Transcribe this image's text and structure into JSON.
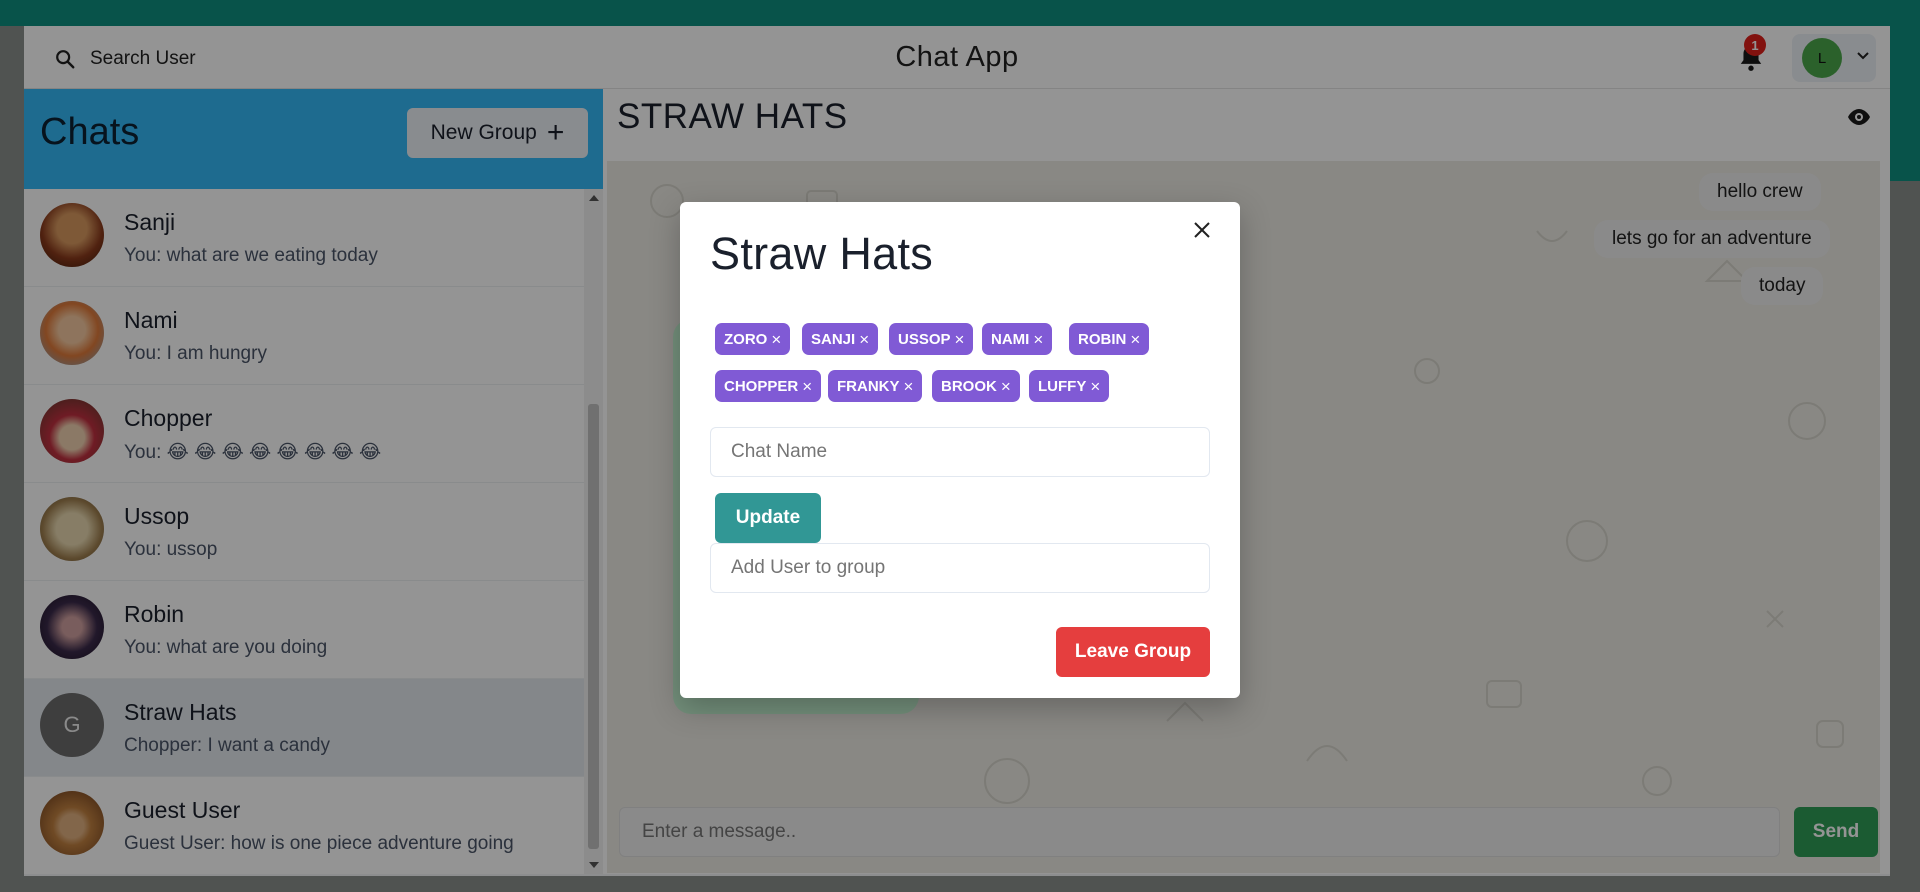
{
  "header": {
    "search_label": "Search User",
    "app_title": "Chat App",
    "notification_count": "1",
    "profile_initial": "L"
  },
  "sidebar": {
    "title": "Chats",
    "new_group_label": "New Group",
    "chats": [
      {
        "name": "Sanji",
        "preview": "You: what are we eating today",
        "avatar_color": "#8a3a1c"
      },
      {
        "name": "Nami",
        "preview": "You: I am hungry",
        "avatar_color": "#e07a3a"
      },
      {
        "name": "Chopper",
        "preview": "You: 😂 😂 😂 😂 😂 😂 😂 😂",
        "avatar_color": "#5a3a2a"
      },
      {
        "name": "Ussop",
        "preview": "You: ussop",
        "avatar_color": "#a08050"
      },
      {
        "name": "Robin",
        "preview": "You: what are you doing",
        "avatar_color": "#3a2a4a"
      },
      {
        "name": "Straw Hats",
        "preview": "Chopper: I want a candy",
        "avatar_initial": "G",
        "avatar_color": "#6b6b6b"
      },
      {
        "name": "Guest User",
        "preview": "Guest User: how is one piece adventure going",
        "avatar_color": "#6a3a1a"
      }
    ]
  },
  "chat": {
    "title": "STRAW HATS",
    "messages": [
      "hello crew",
      "lets go for an adventure",
      "today"
    ],
    "input_placeholder": "Enter a message..",
    "send_label": "Send"
  },
  "modal": {
    "title": "Straw Hats",
    "members": [
      "ZORO",
      "SANJI",
      "USSOP",
      "NAMI",
      "ROBIN",
      "CHOPPER",
      "FRANKY",
      "BROOK",
      "LUFFY"
    ],
    "chat_name_placeholder": "Chat Name",
    "update_label": "Update",
    "add_user_placeholder": "Add User to group",
    "leave_label": "Leave Group"
  },
  "colors": {
    "accent_teal": "#319795",
    "tag_purple": "#805ad5",
    "danger_red": "#e53e3e",
    "sidebar_header_blue": "#35b9f6",
    "send_green": "#2f9e57"
  }
}
